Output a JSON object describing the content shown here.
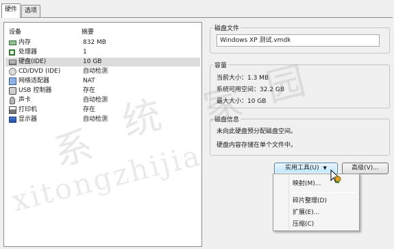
{
  "tabs": [
    {
      "label": "硬件",
      "active": true
    },
    {
      "label": "选项",
      "active": false
    }
  ],
  "device_list": {
    "col_device": "设备",
    "col_summary": "摘要",
    "rows": [
      {
        "icon": "memory-icon",
        "name": "内存",
        "summary": "832 MB",
        "selected": false
      },
      {
        "icon": "processor-icon",
        "name": "处理器",
        "summary": "1",
        "selected": false
      },
      {
        "icon": "hard-disk-icon",
        "name": "硬盘(IDE)",
        "summary": "10 GB",
        "selected": true
      },
      {
        "icon": "cd-dvd-icon",
        "name": "CD/DVD (IDE)",
        "summary": "自动检测",
        "selected": false
      },
      {
        "icon": "network-adapter-icon",
        "name": "网络适配器",
        "summary": "NAT",
        "selected": false
      },
      {
        "icon": "usb-controller-icon",
        "name": "USB 控制器",
        "summary": "存在",
        "selected": false
      },
      {
        "icon": "sound-card-icon",
        "name": "声卡",
        "summary": "自动检测",
        "selected": false
      },
      {
        "icon": "printer-icon",
        "name": "打印机",
        "summary": "存在",
        "selected": false
      },
      {
        "icon": "display-icon",
        "name": "显示器",
        "summary": "自动检测",
        "selected": false
      }
    ]
  },
  "disk_file": {
    "label": "磁盘文件",
    "value": "Windows XP 测试.vmdk"
  },
  "capacity": {
    "label": "容量",
    "current_size": "当前大小：1.3 MB",
    "system_free": "系统可用空间：32.2 GB",
    "max_size": "最大大小：10 GB"
  },
  "disk_info": {
    "label": "磁盘信息",
    "line1": "未向此硬盘预分配磁盘空间。",
    "line2": "硬盘内容存储在单个文件中。"
  },
  "buttons": {
    "utilities": "实用工具(U)",
    "utilities_arrow": "▼",
    "advanced": "高级(V)..."
  },
  "utilities_menu": {
    "items": [
      "映射(M)...",
      "碎片整理(D)",
      "扩展(E)...",
      "压缩(C)"
    ]
  },
  "watermark": {
    "glyphs": [
      "系",
      "统",
      "家",
      "园"
    ],
    "latin": "xitongzhijia"
  }
}
